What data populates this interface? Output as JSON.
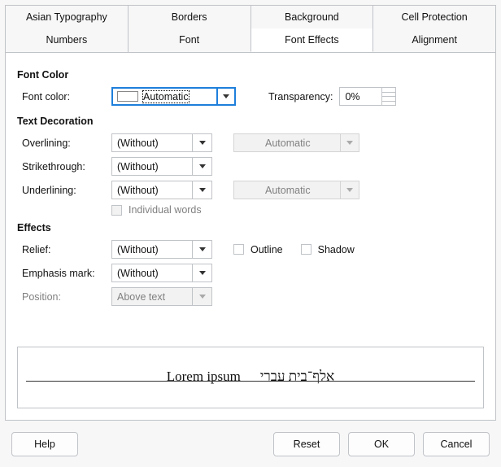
{
  "tabs": {
    "row1": [
      "Asian Typography",
      "Borders",
      "Background",
      "Cell Protection"
    ],
    "row2": [
      "Numbers",
      "Font",
      "Font Effects",
      "Alignment"
    ],
    "active": "Font Effects"
  },
  "sections": {
    "font_color": "Font Color",
    "text_decoration": "Text Decoration",
    "effects": "Effects"
  },
  "font_color": {
    "label": "Font color:",
    "value": "Automatic",
    "transparency_label": "Transparency:",
    "transparency_value": "0%"
  },
  "decoration": {
    "overlining_label": "Overlining:",
    "overlining_value": "(Without)",
    "overlining_color": "Automatic",
    "strike_label": "Strikethrough:",
    "strike_value": "(Without)",
    "underlining_label": "Underlining:",
    "underlining_value": "(Without)",
    "underlining_color": "Automatic",
    "individual_words": "Individual words"
  },
  "effects": {
    "relief_label": "Relief:",
    "relief_value": "(Without)",
    "outline_label": "Outline",
    "shadow_label": "Shadow",
    "emphasis_label": "Emphasis mark:",
    "emphasis_value": "(Without)",
    "position_label": "Position:",
    "position_value": "Above text"
  },
  "preview": {
    "latin": "Lorem ipsum",
    "rtl": "אלף־בית עברי"
  },
  "buttons": {
    "help": "Help",
    "reset": "Reset",
    "ok": "OK",
    "cancel": "Cancel"
  }
}
